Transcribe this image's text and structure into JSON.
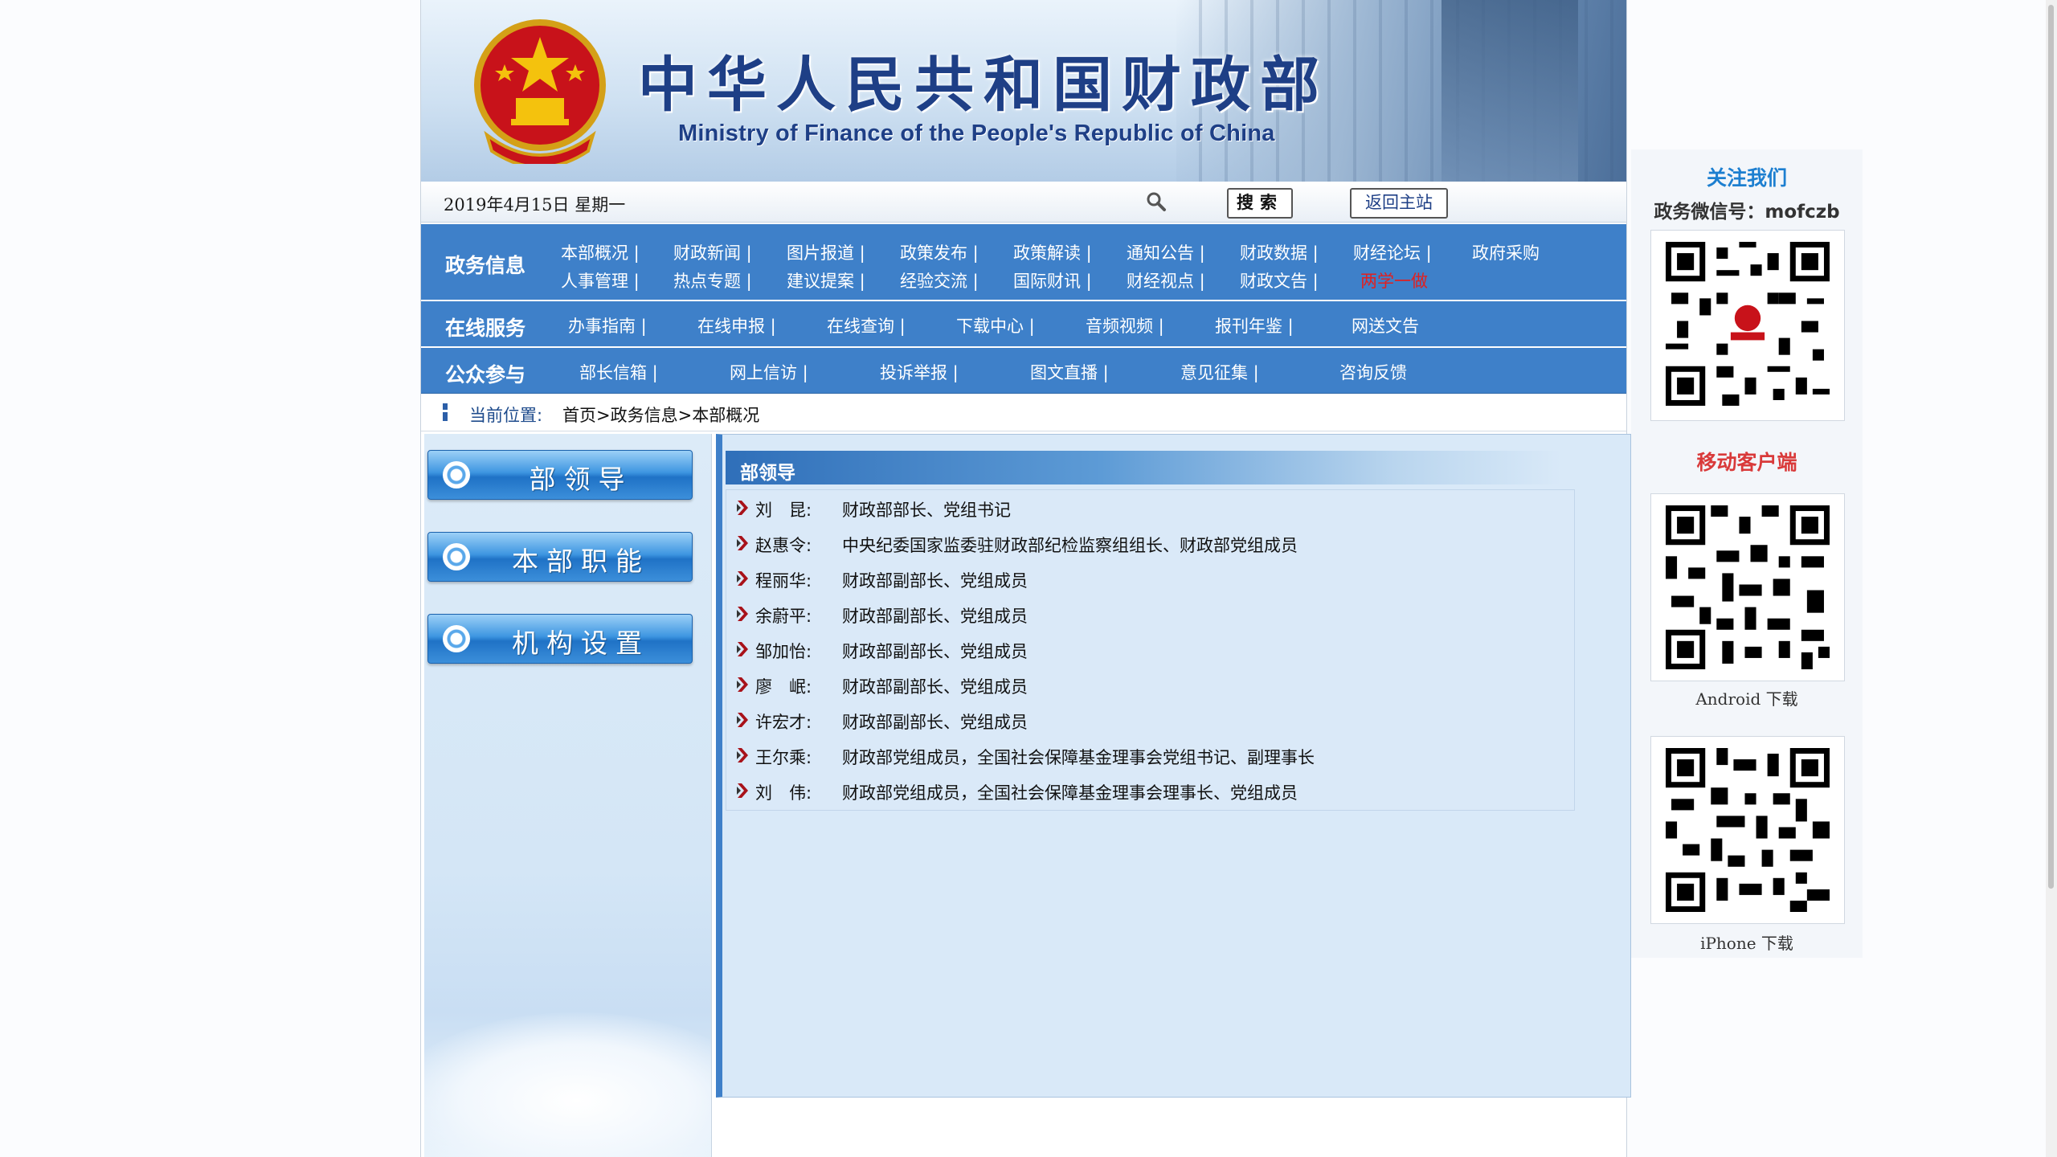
{
  "header": {
    "title_cn": "中华人民共和国财政部",
    "title_en": "Ministry of Finance of the People's Republic of China",
    "date": "2019年4月15日 星期一",
    "search_label": "搜索",
    "home_label": "返回主站"
  },
  "nav": {
    "gov_info": {
      "label": "政务信息",
      "row1": [
        "本部概况 |",
        "财政新闻 |",
        "图片报道 |",
        "政策发布 |",
        "政策解读 |",
        "通知公告 |",
        "财政数据 |",
        "财经论坛 |",
        "政府采购"
      ],
      "row2": [
        "人事管理 |",
        "热点专题 |",
        "建议提案 |",
        "经验交流 |",
        "国际财讯 |",
        "财经视点 |",
        "财政文告 |",
        "两学一做"
      ]
    },
    "online": {
      "label": "在线服务",
      "items": [
        "办事指南 |",
        "在线申报 |",
        "在线查询 |",
        "下载中心 |",
        "音频视频 |",
        "报刊年鉴 |",
        "网送文告"
      ]
    },
    "public": {
      "label": "公众参与",
      "items": [
        "部长信箱 |",
        "网上信访 |",
        "投诉举报 |",
        "图文直播 |",
        "意见征集 |",
        "咨询反馈"
      ]
    }
  },
  "breadcrumb": {
    "label": "当前位置:",
    "path": "首页>政务信息>本部概况"
  },
  "sidebar": {
    "items": [
      "部领导",
      "本部职能",
      "机构设置"
    ]
  },
  "content": {
    "heading": "部领导",
    "leaders": [
      {
        "name": "刘　昆:",
        "role": "财政部部长、党组书记"
      },
      {
        "name": "赵惠令:",
        "role": "中央纪委国家监委驻财政部纪检监察组组长、财政部党组成员"
      },
      {
        "name": "程丽华:",
        "role": "财政部副部长、党组成员"
      },
      {
        "name": "余蔚平:",
        "role": "财政部副部长、党组成员"
      },
      {
        "name": "邹加怡:",
        "role": "财政部副部长、党组成员"
      },
      {
        "name": "廖　岷:",
        "role": "财政部副部长、党组成员"
      },
      {
        "name": "许宏才:",
        "role": "财政部副部长、党组成员"
      },
      {
        "name": "王尔乘:",
        "role": "财政部党组成员，全国社会保障基金理事会党组书记、副理事长"
      },
      {
        "name": "刘　伟:",
        "role": "财政部党组成员，全国社会保障基金理事会理事长、党组成员"
      }
    ]
  },
  "qr": {
    "follow_title": "关注我们",
    "wechat": "政务微信号：mofczb",
    "mobile_title": "移动客户端",
    "android_caption": "Android 下载",
    "iphone_caption": "iPhone 下载"
  },
  "colors": {
    "nav_blue": "#3e80c9",
    "title_blue": "#1e3f86",
    "highlight_red": "#e02020",
    "follow_blue": "#1d7fd0",
    "mobile_red": "#d93a3a"
  }
}
